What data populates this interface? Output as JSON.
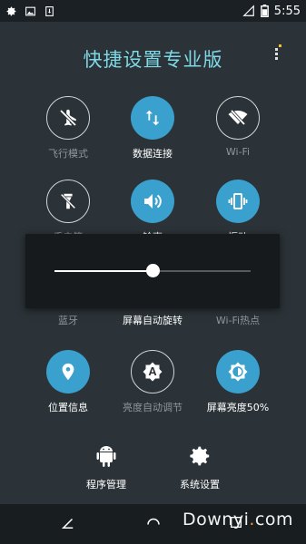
{
  "status_bar": {
    "time": "5:55",
    "left_icons": [
      "gear-icon",
      "image-icon",
      "download-icon"
    ],
    "right_icons": [
      "signal-icon",
      "battery-icon"
    ]
  },
  "app": {
    "title": "快捷设置专业版"
  },
  "tiles": [
    {
      "id": "airplane",
      "label": "飞行模式",
      "state": "off",
      "icon": "airplane-off-icon"
    },
    {
      "id": "data",
      "label": "数据连接",
      "state": "on",
      "icon": "data-transfer-icon"
    },
    {
      "id": "wifi",
      "label": "Wi-Fi",
      "state": "off",
      "icon": "wifi-off-icon"
    },
    {
      "id": "flashlight",
      "label": "手电筒",
      "state": "off",
      "icon": "flashlight-off-icon"
    },
    {
      "id": "ringtone",
      "label": "铃声",
      "state": "on",
      "icon": "volume-icon"
    },
    {
      "id": "vibrate",
      "label": "振动",
      "state": "on",
      "icon": "vibrate-icon"
    },
    {
      "id": "bluetooth",
      "label": "蓝牙",
      "state": "off",
      "icon": "bluetooth-off-icon"
    },
    {
      "id": "autorotate",
      "label": "屏幕自动旋转",
      "state": "on",
      "icon": "rotate-icon"
    },
    {
      "id": "hotspot",
      "label": "Wi-Fi热点",
      "state": "off",
      "icon": "hotspot-icon"
    },
    {
      "id": "location",
      "label": "位置信息",
      "state": "on",
      "icon": "location-icon"
    },
    {
      "id": "auto_brightness",
      "label": "亮度自动调节",
      "state": "off",
      "icon": "auto-brightness-icon"
    },
    {
      "id": "brightness",
      "label": "屏幕亮度50%",
      "state": "on",
      "icon": "brightness-icon"
    }
  ],
  "bottom": {
    "app_manager": "程序管理",
    "system_settings": "系统设置"
  },
  "brightness_slider": {
    "value": 0.5
  },
  "watermark": {
    "prefix": "Downyi",
    "dot": ".",
    "suffix": "com"
  },
  "colors": {
    "accent": "#3aa0cd",
    "title": "#7fd8e6",
    "background": "#2b3338"
  }
}
